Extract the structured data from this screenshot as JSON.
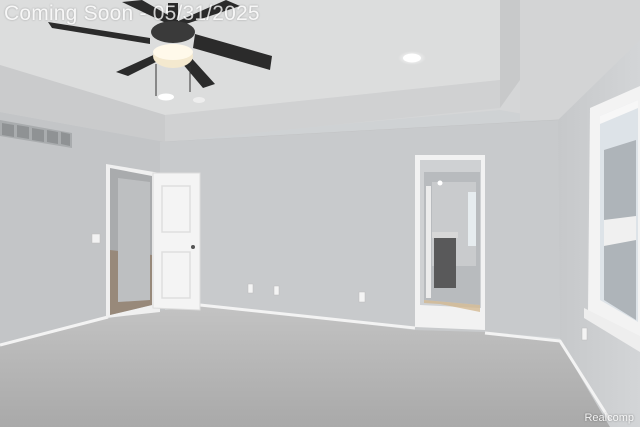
{
  "overlay": {
    "banner_text": "Coming Soon - 05/31/2025",
    "watermark_text": "Realcomp"
  },
  "palette": {
    "wall": "#c9cbcd",
    "wall_shadow": "#b7b9bb",
    "ceiling": "#d9dadb",
    "carpet": "#bcbcbc",
    "trim": "#f2f2f2",
    "fan_blade": "#2b2b2b",
    "light_glow": "#fff8e6",
    "window_sky": "#e8edf2"
  },
  "scene_elements": [
    "ceiling-fan-icon",
    "recessed-light-icon",
    "air-vent-icon",
    "open-door-icon",
    "window-icon",
    "hallway-doorway",
    "carpet-floor",
    "electrical-outlet-icon"
  ]
}
